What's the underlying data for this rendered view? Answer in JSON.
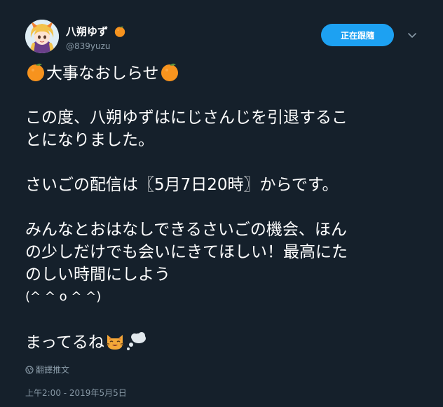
{
  "user": {
    "display_name": "八朔ゆず",
    "handle": "@839yuzu"
  },
  "follow_button": {
    "label": "正在跟隨"
  },
  "tweet": {
    "title_text": "大事なおしらせ",
    "lines": [
      "この度、八朔ゆずはにじさんじを引退するこ",
      "とになりました。",
      "さいごの配信は〖5月7日20時〗からです。",
      "みんなとおはなしできるさいごの機会、ほん",
      "の少しだけでも会いにきてほしい！最高にた",
      "のしい時間にしよう",
      "(^ ^ o ^ ^)",
      "まってるね"
    ]
  },
  "translate_label": "翻譯推文",
  "timestamp": "上午2:00 - 2019年5月5日",
  "icons": {
    "orange": "orange-emoji-icon",
    "cat": "smiling-cat-emoji-icon",
    "thought": "thought-balloon-emoji-icon",
    "globe": "globe-icon",
    "caret": "chevron-down-icon"
  },
  "colors": {
    "background": "#15202b",
    "accent": "#1da1f2",
    "secondary_text": "#8899a6",
    "orange": "#f7931e"
  }
}
